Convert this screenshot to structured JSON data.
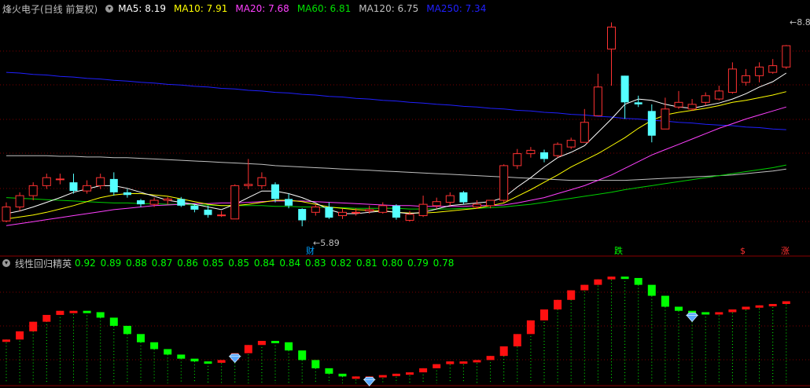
{
  "header": {
    "title": "烽火电子(日线 前复权)",
    "ma": [
      {
        "label": "MA5: 8.19",
        "color": "#ffffff"
      },
      {
        "label": "MA10: 7.91",
        "color": "#ffff00"
      },
      {
        "label": "MA20: 7.68",
        "color": "#ff40ff"
      },
      {
        "label": "MA60: 6.81",
        "color": "#00e000"
      },
      {
        "label": "MA120: 6.75",
        "color": "#c0c0c0"
      },
      {
        "label": "MA250: 7.34",
        "color": "#2020ff"
      }
    ]
  },
  "price_labels": {
    "low": "5.89",
    "high": "8.8"
  },
  "event_markers": [
    {
      "label": "财",
      "color": "#00a0ff"
    },
    {
      "label": "跌",
      "color": "#00ff00"
    },
    {
      "label": "$",
      "color": "#ff3030"
    },
    {
      "label": "涨",
      "color": "#ff3030"
    }
  ],
  "indicator": {
    "title": "线性回归精英",
    "values": [
      "0.92",
      "0.89",
      "0.88",
      "0.87",
      "0.86",
      "0.85",
      "0.85",
      "0.84",
      "0.84",
      "0.83",
      "0.82",
      "0.81",
      "0.80",
      "0.79",
      "0.78"
    ],
    "value_color": "#00ff00"
  },
  "colors": {
    "up": "#ff3232",
    "down": "#54ffff",
    "grid": "#7a0000",
    "ind_up": "#ff1010",
    "ind_down": "#00ff00"
  },
  "chart_data": {
    "type": "candlestick",
    "candles": [
      [
        5.97,
        6.18,
        5.95,
        6.25
      ],
      [
        6.18,
        6.35,
        6.12,
        6.4
      ],
      [
        6.35,
        6.5,
        6.28,
        6.55
      ],
      [
        6.5,
        6.62,
        6.45,
        6.68
      ],
      [
        6.6,
        6.6,
        6.52,
        6.68
      ],
      [
        6.55,
        6.42,
        6.38,
        6.68
      ],
      [
        6.42,
        6.5,
        6.38,
        6.58
      ],
      [
        6.5,
        6.62,
        6.45,
        6.68
      ],
      [
        6.6,
        6.4,
        6.35,
        6.7
      ],
      [
        6.4,
        6.36,
        6.32,
        6.45
      ],
      [
        6.28,
        6.22,
        6.18,
        6.3
      ],
      [
        6.22,
        6.28,
        6.18,
        6.32
      ],
      [
        6.28,
        6.3,
        6.22,
        6.33
      ],
      [
        6.3,
        6.2,
        6.18,
        6.33
      ],
      [
        6.2,
        6.14,
        6.1,
        6.22
      ],
      [
        6.14,
        6.06,
        6.02,
        6.2
      ],
      [
        6.06,
        6.06,
        6.03,
        6.12
      ],
      [
        6.0,
        6.5,
        6.0,
        6.52
      ],
      [
        6.5,
        6.52,
        6.45,
        6.9
      ],
      [
        6.5,
        6.62,
        6.45,
        6.7
      ],
      [
        6.52,
        6.3,
        6.25,
        6.55
      ],
      [
        6.3,
        6.2,
        6.16,
        6.38
      ],
      [
        6.15,
        5.98,
        5.89,
        6.16
      ],
      [
        6.1,
        6.18,
        6.05,
        6.22
      ],
      [
        6.18,
        6.02,
        6.0,
        6.25
      ],
      [
        6.05,
        6.1,
        6.0,
        6.15
      ],
      [
        6.1,
        6.1,
        6.05,
        6.16
      ],
      [
        6.12,
        6.14,
        6.08,
        6.2
      ],
      [
        6.1,
        6.2,
        6.08,
        6.25
      ],
      [
        6.2,
        6.02,
        5.99,
        6.22
      ],
      [
        5.98,
        6.07,
        5.96,
        6.12
      ],
      [
        6.05,
        6.22,
        6.03,
        6.35
      ],
      [
        6.2,
        6.26,
        6.16,
        6.32
      ],
      [
        6.25,
        6.35,
        6.2,
        6.4
      ],
      [
        6.4,
        6.25,
        6.22,
        6.42
      ],
      [
        6.18,
        6.22,
        6.15,
        6.28
      ],
      [
        6.2,
        6.28,
        6.16,
        6.28
      ],
      [
        6.28,
        6.8,
        6.25,
        6.82
      ],
      [
        6.8,
        6.98,
        6.75,
        7.05
      ],
      [
        6.98,
        7.03,
        6.92,
        7.08
      ],
      [
        7.0,
        6.9,
        6.85,
        7.04
      ],
      [
        6.95,
        7.12,
        6.92,
        7.15
      ],
      [
        7.08,
        7.18,
        7.05,
        7.22
      ],
      [
        7.15,
        7.45,
        7.15,
        7.65
      ],
      [
        7.55,
        7.98,
        7.55,
        8.18
      ],
      [
        8.55,
        8.88,
        8.0,
        8.95
      ],
      [
        8.15,
        7.75,
        7.5,
        8.15
      ],
      [
        7.75,
        7.72,
        7.68,
        7.85
      ],
      [
        7.62,
        7.25,
        7.15,
        7.72
      ],
      [
        7.35,
        7.65,
        7.35,
        7.82
      ],
      [
        7.68,
        7.75,
        7.65,
        7.92
      ],
      [
        7.65,
        7.72,
        7.62,
        7.8
      ],
      [
        7.75,
        7.85,
        7.7,
        7.9
      ],
      [
        7.8,
        7.92,
        7.78,
        8.0
      ],
      [
        7.9,
        8.25,
        7.88,
        8.35
      ],
      [
        8.05,
        8.15,
        8.0,
        8.25
      ],
      [
        8.15,
        8.28,
        8.05,
        8.35
      ],
      [
        8.2,
        8.3,
        8.18,
        8.4
      ],
      [
        8.28,
        8.6,
        8.25,
        8.61
      ]
    ],
    "ma5": [
      6.08,
      6.12,
      6.18,
      6.25,
      6.32,
      6.4,
      6.45,
      6.5,
      6.5,
      6.46,
      6.4,
      6.34,
      6.28,
      6.25,
      6.22,
      6.18,
      6.14,
      6.22,
      6.32,
      6.42,
      6.42,
      6.38,
      6.32,
      6.24,
      6.14,
      6.08,
      6.08,
      6.1,
      6.12,
      6.1,
      6.08,
      6.1,
      6.15,
      6.2,
      6.22,
      6.24,
      6.26,
      6.32,
      6.48,
      6.62,
      6.78,
      6.92,
      7.0,
      7.1,
      7.3,
      7.5,
      7.72,
      7.8,
      7.78,
      7.72,
      7.68,
      7.66,
      7.7,
      7.74,
      7.8,
      7.88,
      7.98,
      8.06,
      8.19
    ],
    "ma10": [
      6.0,
      6.03,
      6.06,
      6.1,
      6.15,
      6.2,
      6.26,
      6.32,
      6.36,
      6.38,
      6.38,
      6.36,
      6.34,
      6.3,
      6.26,
      6.22,
      6.2,
      6.2,
      6.22,
      6.25,
      6.28,
      6.28,
      6.26,
      6.22,
      6.18,
      6.16,
      6.14,
      6.13,
      6.12,
      6.1,
      6.09,
      6.09,
      6.1,
      6.12,
      6.14,
      6.16,
      6.2,
      6.24,
      6.34,
      6.44,
      6.55,
      6.66,
      6.78,
      6.88,
      6.98,
      7.1,
      7.22,
      7.36,
      7.48,
      7.56,
      7.6,
      7.63,
      7.66,
      7.7,
      7.75,
      7.78,
      7.82,
      7.86,
      7.91
    ],
    "ma20": [
      5.9,
      5.93,
      5.96,
      5.99,
      6.02,
      6.05,
      6.08,
      6.11,
      6.14,
      6.16,
      6.18,
      6.2,
      6.21,
      6.22,
      6.23,
      6.23,
      6.24,
      6.24,
      6.25,
      6.26,
      6.27,
      6.27,
      6.27,
      6.26,
      6.25,
      6.24,
      6.23,
      6.22,
      6.21,
      6.2,
      6.2,
      6.19,
      6.19,
      6.19,
      6.19,
      6.2,
      6.2,
      6.21,
      6.24,
      6.28,
      6.32,
      6.38,
      6.44,
      6.5,
      6.58,
      6.66,
      6.76,
      6.86,
      6.96,
      7.04,
      7.12,
      7.2,
      7.28,
      7.36,
      7.43,
      7.5,
      7.56,
      7.62,
      7.68
    ],
    "ma60": [
      6.32,
      6.31,
      6.3,
      6.29,
      6.28,
      6.27,
      6.26,
      6.25,
      6.24,
      6.24,
      6.23,
      6.23,
      6.22,
      6.22,
      6.21,
      6.21,
      6.2,
      6.2,
      6.2,
      6.2,
      6.19,
      6.19,
      6.18,
      6.18,
      6.17,
      6.17,
      6.16,
      6.16,
      6.16,
      6.16,
      6.15,
      6.15,
      6.15,
      6.15,
      6.16,
      6.16,
      6.17,
      6.18,
      6.2,
      6.22,
      6.25,
      6.28,
      6.31,
      6.34,
      6.37,
      6.4,
      6.44,
      6.47,
      6.5,
      6.53,
      6.56,
      6.59,
      6.62,
      6.65,
      6.68,
      6.71,
      6.74,
      6.77,
      6.81
    ],
    "ma120": [
      6.95,
      6.95,
      6.95,
      6.95,
      6.94,
      6.94,
      6.93,
      6.93,
      6.92,
      6.92,
      6.91,
      6.9,
      6.89,
      6.88,
      6.87,
      6.86,
      6.85,
      6.84,
      6.83,
      6.82,
      6.8,
      6.79,
      6.78,
      6.77,
      6.76,
      6.75,
      6.74,
      6.73,
      6.72,
      6.71,
      6.7,
      6.69,
      6.68,
      6.67,
      6.66,
      6.65,
      6.64,
      6.63,
      6.62,
      6.61,
      6.6,
      6.59,
      6.58,
      6.58,
      6.58,
      6.58,
      6.58,
      6.59,
      6.6,
      6.61,
      6.62,
      6.63,
      6.64,
      6.65,
      6.66,
      6.68,
      6.7,
      6.72,
      6.75
    ],
    "ma250": [
      8.2,
      8.19,
      8.17,
      8.16,
      8.14,
      8.13,
      8.11,
      8.1,
      8.08,
      8.07,
      8.05,
      8.04,
      8.02,
      8.01,
      7.99,
      7.98,
      7.96,
      7.95,
      7.93,
      7.92,
      7.9,
      7.89,
      7.87,
      7.86,
      7.84,
      7.83,
      7.81,
      7.8,
      7.78,
      7.77,
      7.75,
      7.74,
      7.72,
      7.71,
      7.69,
      7.68,
      7.66,
      7.65,
      7.63,
      7.62,
      7.6,
      7.59,
      7.57,
      7.56,
      7.54,
      7.53,
      7.51,
      7.5,
      7.48,
      7.47,
      7.45,
      7.44,
      7.42,
      7.41,
      7.4,
      7.38,
      7.37,
      7.35,
      7.34
    ],
    "y_range": [
      5.75,
      9.05
    ],
    "regression": [
      0.42,
      0.48,
      0.55,
      0.6,
      0.63,
      0.63,
      0.62,
      0.58,
      0.52,
      0.46,
      0.4,
      0.35,
      0.31,
      0.28,
      0.26,
      0.25,
      0.27,
      0.32,
      0.38,
      0.41,
      0.4,
      0.34,
      0.27,
      0.21,
      0.17,
      0.15,
      0.15,
      0.15,
      0.16,
      0.17,
      0.18,
      0.21,
      0.24,
      0.26,
      0.26,
      0.27,
      0.3,
      0.37,
      0.46,
      0.56,
      0.64,
      0.71,
      0.78,
      0.82,
      0.86,
      0.88,
      0.87,
      0.82,
      0.74,
      0.66,
      0.63,
      0.62,
      0.61,
      0.62,
      0.64,
      0.66,
      0.67,
      0.68,
      0.7
    ],
    "regression_range": [
      0.1,
      0.95
    ],
    "diamonds": [
      17,
      27,
      51
    ]
  }
}
